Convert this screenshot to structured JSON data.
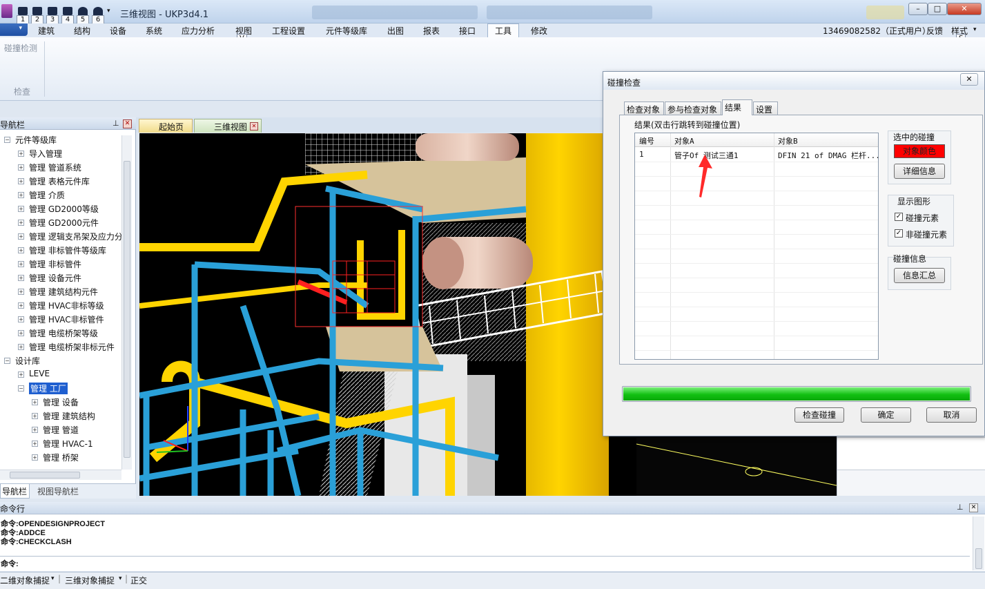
{
  "app": {
    "title": "三维视图 - UKP3d4.1",
    "user": "13469082582（正式用户）",
    "feedback": "反馈",
    "style_menu": "样式"
  },
  "quick_access": {
    "keytips": [
      "1",
      "2",
      "3",
      "4",
      "5",
      "6"
    ]
  },
  "taskbar_ghosts": [
    "",
    "",
    ""
  ],
  "window_controls": {
    "min": "–",
    "max": "□",
    "close": "✕"
  },
  "ribbon": {
    "tabs": [
      "建筑",
      "结构",
      "设备",
      "系统",
      "应力分析",
      "视图",
      "工程设置",
      "元件等级库",
      "出图",
      "报表",
      "接口",
      "工具",
      "修改"
    ],
    "active_tab": "工具",
    "keytips": {
      "view": "V",
      "style": "S"
    },
    "group_item": "碰撞检测",
    "group_label": "检查"
  },
  "nav": {
    "title": "导航栏",
    "tree": [
      {
        "label": "元件等级库",
        "level": 0,
        "toggle": "−"
      },
      {
        "label": "导入管理",
        "level": 1,
        "toggle": "+"
      },
      {
        "label": "管理 管道系统",
        "level": 1,
        "toggle": "+"
      },
      {
        "label": "管理 表格元件库",
        "level": 1,
        "toggle": "+"
      },
      {
        "label": "管理 介质",
        "level": 1,
        "toggle": "+"
      },
      {
        "label": "管理 GD2000等级",
        "level": 1,
        "toggle": "+"
      },
      {
        "label": "管理 GD2000元件",
        "level": 1,
        "toggle": "+"
      },
      {
        "label": "管理 逻辑支吊架及应力分",
        "level": 1,
        "toggle": "+"
      },
      {
        "label": "管理 非标管件等级库",
        "level": 1,
        "toggle": "+"
      },
      {
        "label": "管理 非标管件",
        "level": 1,
        "toggle": "+"
      },
      {
        "label": "管理 设备元件",
        "level": 1,
        "toggle": "+"
      },
      {
        "label": "管理 建筑结构元件",
        "level": 1,
        "toggle": "+"
      },
      {
        "label": "管理 HVAC非标等级",
        "level": 1,
        "toggle": "+"
      },
      {
        "label": "管理 HVAC非标管件",
        "level": 1,
        "toggle": "+"
      },
      {
        "label": "管理 电缆桥架等级",
        "level": 1,
        "toggle": "+"
      },
      {
        "label": "管理 电缆桥架非标元件",
        "level": 1,
        "toggle": "+"
      },
      {
        "label": "设计库",
        "level": 0,
        "toggle": "−"
      },
      {
        "label": "LEVE",
        "level": 1,
        "toggle": "+"
      },
      {
        "label": "管理 工厂",
        "level": 1,
        "toggle": "−",
        "selected": true
      },
      {
        "label": "管理 设备",
        "level": 2,
        "toggle": "+"
      },
      {
        "label": "管理 建筑结构",
        "level": 2,
        "toggle": "+"
      },
      {
        "label": "管理 管道",
        "level": 2,
        "toggle": "+"
      },
      {
        "label": "管理 HVAC-1",
        "level": 2,
        "toggle": "+"
      },
      {
        "label": "管理 桥架",
        "level": 2,
        "toggle": "+"
      }
    ],
    "bottom_tabs": [
      "导航栏",
      "视图导航栏"
    ]
  },
  "doc_tabs": [
    "起始页",
    "三维视图"
  ],
  "command": {
    "title": "命令行",
    "history": [
      "命令:OPENDESIGNPROJECT",
      "命令:ADDCE",
      "命令:CHECKCLASH"
    ],
    "prompt": "命令:"
  },
  "status": {
    "items": [
      "二维对象捕捉",
      "三维对象捕捉",
      "正交"
    ]
  },
  "dialog": {
    "title": "碰撞检查",
    "tabs": [
      "检查对象",
      "参与检查对象",
      "结果",
      "设置"
    ],
    "active_tab": "结果",
    "results_caption": "结果(双击行跳转到碰撞位置)",
    "columns": [
      "编号",
      "对象A",
      "对象B"
    ],
    "rows": [
      {
        "id": "1",
        "a": "管子Of 测试三通1",
        "b": "DFIN 21 of DMAG 栏杆..."
      }
    ],
    "selected_group": "选中的碰撞",
    "color_btn": "对象颜色",
    "detail_btn": "详细信息",
    "display_group": "显示图形",
    "chk_clash": "碰撞元素",
    "chk_nonclash": "非碰撞元素",
    "info_group": "碰撞信息",
    "summary_btn": "信息汇总",
    "progress": 1.0,
    "btn_check": "检查碰撞",
    "btn_ok": "确定",
    "btn_cancel": "取消",
    "close": "✕"
  }
}
